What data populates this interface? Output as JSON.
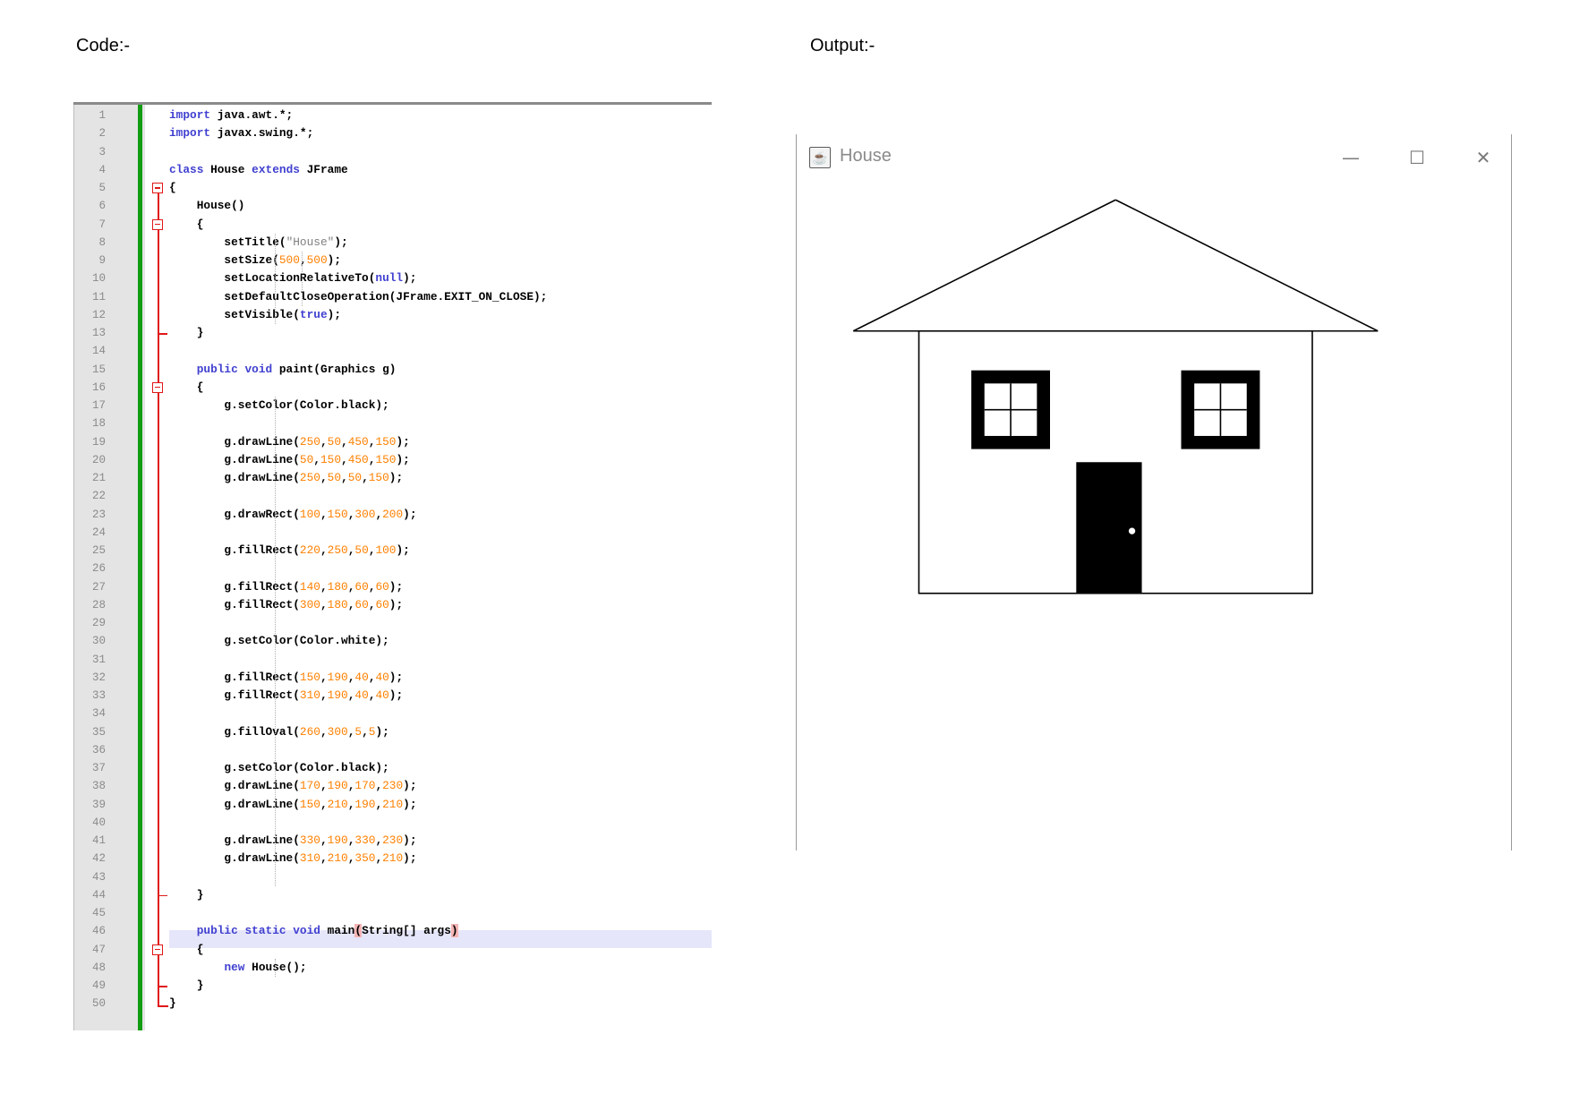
{
  "headings": {
    "code": "Code:-",
    "output": "Output:-"
  },
  "editor": {
    "lines": [
      {
        "n": "1",
        "t": [
          [
            "kw",
            "import"
          ],
          [
            "",
            " java.awt.*;"
          ]
        ]
      },
      {
        "n": "2",
        "t": [
          [
            "kw",
            "import"
          ],
          [
            "",
            " javax.swing.*;"
          ]
        ]
      },
      {
        "n": "3",
        "t": []
      },
      {
        "n": "4",
        "t": [
          [
            "kw",
            "class"
          ],
          [
            "",
            " House "
          ],
          [
            "kw",
            "extends"
          ],
          [
            "",
            " JFrame"
          ]
        ]
      },
      {
        "n": "5",
        "t": [
          [
            "",
            "{"
          ]
        ]
      },
      {
        "n": "6",
        "t": [
          [
            "",
            "    House()"
          ]
        ]
      },
      {
        "n": "7",
        "t": [
          [
            "",
            "    {"
          ]
        ]
      },
      {
        "n": "8",
        "t": [
          [
            "",
            "        setTitle("
          ],
          [
            "str",
            "\"House\""
          ],
          [
            "",
            ");"
          ]
        ]
      },
      {
        "n": "9",
        "t": [
          [
            "",
            "        setSize("
          ],
          [
            "num",
            "500"
          ],
          [
            "",
            ","
          ],
          [
            "num",
            "500"
          ],
          [
            "",
            ");"
          ]
        ]
      },
      {
        "n": "10",
        "t": [
          [
            "",
            "        setLocationRelativeTo("
          ],
          [
            "kw",
            "null"
          ],
          [
            "",
            ");"
          ]
        ]
      },
      {
        "n": "11",
        "t": [
          [
            "",
            "        setDefaultCloseOperation(JFrame.EXIT_ON_CLOSE);"
          ]
        ]
      },
      {
        "n": "12",
        "t": [
          [
            "",
            "        setVisible("
          ],
          [
            "kw",
            "true"
          ],
          [
            "",
            ");"
          ]
        ]
      },
      {
        "n": "13",
        "t": [
          [
            "",
            "    }"
          ]
        ]
      },
      {
        "n": "14",
        "t": []
      },
      {
        "n": "15",
        "t": [
          [
            "",
            "    "
          ],
          [
            "kw",
            "public"
          ],
          [
            "",
            " "
          ],
          [
            "kw",
            "void"
          ],
          [
            "",
            " paint(Graphics g)"
          ]
        ]
      },
      {
        "n": "16",
        "t": [
          [
            "",
            "    {"
          ]
        ]
      },
      {
        "n": "17",
        "t": [
          [
            "",
            "        g.setColor(Color.black);"
          ]
        ]
      },
      {
        "n": "18",
        "t": []
      },
      {
        "n": "19",
        "t": [
          [
            "",
            "        g.drawLine("
          ],
          [
            "num",
            "250"
          ],
          [
            "",
            ","
          ],
          [
            "num",
            "50"
          ],
          [
            "",
            ","
          ],
          [
            "num",
            "450"
          ],
          [
            "",
            ","
          ],
          [
            "num",
            "150"
          ],
          [
            "",
            ");"
          ]
        ]
      },
      {
        "n": "20",
        "t": [
          [
            "",
            "        g.drawLine("
          ],
          [
            "num",
            "50"
          ],
          [
            "",
            ","
          ],
          [
            "num",
            "150"
          ],
          [
            "",
            ","
          ],
          [
            "num",
            "450"
          ],
          [
            "",
            ","
          ],
          [
            "num",
            "150"
          ],
          [
            "",
            ");"
          ]
        ]
      },
      {
        "n": "21",
        "t": [
          [
            "",
            "        g.drawLine("
          ],
          [
            "num",
            "250"
          ],
          [
            "",
            ","
          ],
          [
            "num",
            "50"
          ],
          [
            "",
            ","
          ],
          [
            "num",
            "50"
          ],
          [
            "",
            ","
          ],
          [
            "num",
            "150"
          ],
          [
            "",
            ");"
          ]
        ]
      },
      {
        "n": "22",
        "t": []
      },
      {
        "n": "23",
        "t": [
          [
            "",
            "        g.drawRect("
          ],
          [
            "num",
            "100"
          ],
          [
            "",
            ","
          ],
          [
            "num",
            "150"
          ],
          [
            "",
            ","
          ],
          [
            "num",
            "300"
          ],
          [
            "",
            ","
          ],
          [
            "num",
            "200"
          ],
          [
            "",
            ");"
          ]
        ]
      },
      {
        "n": "24",
        "t": []
      },
      {
        "n": "25",
        "t": [
          [
            "",
            "        g.fillRect("
          ],
          [
            "num",
            "220"
          ],
          [
            "",
            ","
          ],
          [
            "num",
            "250"
          ],
          [
            "",
            ","
          ],
          [
            "num",
            "50"
          ],
          [
            "",
            ","
          ],
          [
            "num",
            "100"
          ],
          [
            "",
            ");"
          ]
        ]
      },
      {
        "n": "26",
        "t": []
      },
      {
        "n": "27",
        "t": [
          [
            "",
            "        g.fillRect("
          ],
          [
            "num",
            "140"
          ],
          [
            "",
            ","
          ],
          [
            "num",
            "180"
          ],
          [
            "",
            ","
          ],
          [
            "num",
            "60"
          ],
          [
            "",
            ","
          ],
          [
            "num",
            "60"
          ],
          [
            "",
            ");"
          ]
        ]
      },
      {
        "n": "28",
        "t": [
          [
            "",
            "        g.fillRect("
          ],
          [
            "num",
            "300"
          ],
          [
            "",
            ","
          ],
          [
            "num",
            "180"
          ],
          [
            "",
            ","
          ],
          [
            "num",
            "60"
          ],
          [
            "",
            ","
          ],
          [
            "num",
            "60"
          ],
          [
            "",
            ");"
          ]
        ]
      },
      {
        "n": "29",
        "t": []
      },
      {
        "n": "30",
        "t": [
          [
            "",
            "        g.setColor(Color.white);"
          ]
        ]
      },
      {
        "n": "31",
        "t": []
      },
      {
        "n": "32",
        "t": [
          [
            "",
            "        g.fillRect("
          ],
          [
            "num",
            "150"
          ],
          [
            "",
            ","
          ],
          [
            "num",
            "190"
          ],
          [
            "",
            ","
          ],
          [
            "num",
            "40"
          ],
          [
            "",
            ","
          ],
          [
            "num",
            "40"
          ],
          [
            "",
            ");"
          ]
        ]
      },
      {
        "n": "33",
        "t": [
          [
            "",
            "        g.fillRect("
          ],
          [
            "num",
            "310"
          ],
          [
            "",
            ","
          ],
          [
            "num",
            "190"
          ],
          [
            "",
            ","
          ],
          [
            "num",
            "40"
          ],
          [
            "",
            ","
          ],
          [
            "num",
            "40"
          ],
          [
            "",
            ");"
          ]
        ]
      },
      {
        "n": "34",
        "t": []
      },
      {
        "n": "35",
        "t": [
          [
            "",
            "        g.fillOval("
          ],
          [
            "num",
            "260"
          ],
          [
            "",
            ","
          ],
          [
            "num",
            "300"
          ],
          [
            "",
            ","
          ],
          [
            "num",
            "5"
          ],
          [
            "",
            ","
          ],
          [
            "num",
            "5"
          ],
          [
            "",
            ");"
          ]
        ]
      },
      {
        "n": "36",
        "t": []
      },
      {
        "n": "37",
        "t": [
          [
            "",
            "        g.setColor(Color.black);"
          ]
        ]
      },
      {
        "n": "38",
        "t": [
          [
            "",
            "        g.drawLine("
          ],
          [
            "num",
            "170"
          ],
          [
            "",
            ","
          ],
          [
            "num",
            "190"
          ],
          [
            "",
            ","
          ],
          [
            "num",
            "170"
          ],
          [
            "",
            ","
          ],
          [
            "num",
            "230"
          ],
          [
            "",
            ");"
          ]
        ]
      },
      {
        "n": "39",
        "t": [
          [
            "",
            "        g.drawLine("
          ],
          [
            "num",
            "150"
          ],
          [
            "",
            ","
          ],
          [
            "num",
            "210"
          ],
          [
            "",
            ","
          ],
          [
            "num",
            "190"
          ],
          [
            "",
            ","
          ],
          [
            "num",
            "210"
          ],
          [
            "",
            ");"
          ]
        ]
      },
      {
        "n": "40",
        "t": []
      },
      {
        "n": "41",
        "t": [
          [
            "",
            "        g.drawLine("
          ],
          [
            "num",
            "330"
          ],
          [
            "",
            ","
          ],
          [
            "num",
            "190"
          ],
          [
            "",
            ","
          ],
          [
            "num",
            "330"
          ],
          [
            "",
            ","
          ],
          [
            "num",
            "230"
          ],
          [
            "",
            ");"
          ]
        ]
      },
      {
        "n": "42",
        "t": [
          [
            "",
            "        g.drawLine("
          ],
          [
            "num",
            "310"
          ],
          [
            "",
            ","
          ],
          [
            "num",
            "210"
          ],
          [
            "",
            ","
          ],
          [
            "num",
            "350"
          ],
          [
            "",
            ","
          ],
          [
            "num",
            "210"
          ],
          [
            "",
            ");"
          ]
        ]
      },
      {
        "n": "43",
        "t": []
      },
      {
        "n": "44",
        "t": [
          [
            "",
            "    }"
          ]
        ]
      },
      {
        "n": "45",
        "t": []
      },
      {
        "n": "46",
        "t": [
          [
            "",
            "    "
          ],
          [
            "kw",
            "public"
          ],
          [
            "",
            " "
          ],
          [
            "kw",
            "static"
          ],
          [
            "",
            " "
          ],
          [
            "kw",
            "void"
          ],
          [
            "",
            " main"
          ],
          [
            "bm",
            "("
          ],
          [
            "",
            "String[] args"
          ],
          [
            "bm",
            ")"
          ]
        ]
      },
      {
        "n": "47",
        "t": [
          [
            "",
            "    {"
          ]
        ]
      },
      {
        "n": "48",
        "t": [
          [
            "",
            "        "
          ],
          [
            "kw",
            "new"
          ],
          [
            "",
            " House();"
          ]
        ]
      },
      {
        "n": "49",
        "t": [
          [
            "",
            "    }"
          ]
        ]
      },
      {
        "n": "50",
        "t": [
          [
            "",
            "}"
          ]
        ]
      }
    ]
  },
  "window": {
    "title": "House",
    "icon": "java-cup-icon",
    "minimize": "minimize-icon",
    "maximize": "maximize-icon",
    "close": "close-icon"
  },
  "drawing": {
    "frame_size": [
      500,
      500
    ],
    "color_black": "#000000",
    "color_white": "#ffffff",
    "roof_lines": [
      [
        250,
        50,
        450,
        150
      ],
      [
        50,
        150,
        450,
        150
      ],
      [
        250,
        50,
        50,
        150
      ]
    ],
    "wall_rect": [
      100,
      150,
      300,
      200
    ],
    "door_rect": [
      220,
      250,
      50,
      100
    ],
    "windows": [
      [
        140,
        180,
        60,
        60
      ],
      [
        300,
        180,
        60,
        60
      ]
    ],
    "panes": [
      [
        150,
        190,
        40,
        40
      ],
      [
        310,
        190,
        40,
        40
      ]
    ],
    "knob_oval": [
      260,
      300,
      5,
      5
    ],
    "mullions": [
      [
        170,
        190,
        170,
        230
      ],
      [
        150,
        210,
        190,
        210
      ],
      [
        330,
        190,
        330,
        230
      ],
      [
        310,
        210,
        350,
        210
      ]
    ]
  }
}
